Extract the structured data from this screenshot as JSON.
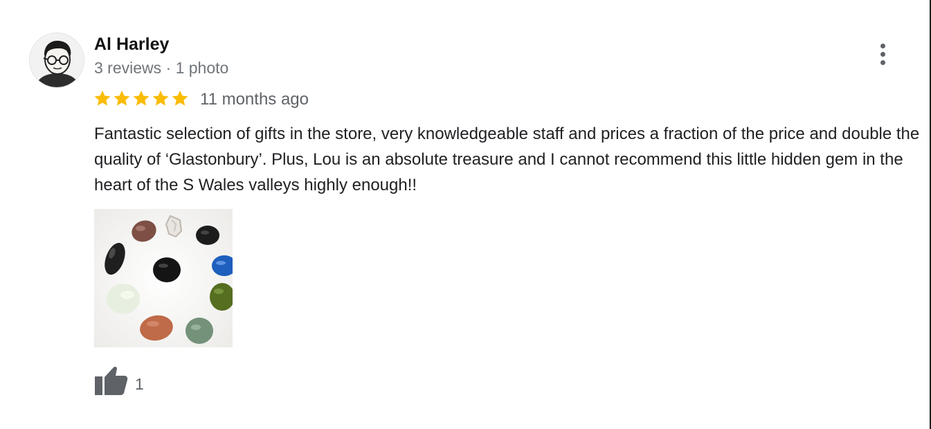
{
  "review": {
    "reviewer_name": "Al Harley",
    "reviewer_meta": "3 reviews · 1 photo",
    "rating": 5,
    "rating_max": 5,
    "time": "11 months ago",
    "text": "Fantastic selection of gifts in the store, very knowledgeable staff and prices a fraction of the price and double the quality of ‘Glastonbury’. Plus, Lou is an absolute treasure and I cannot recommend this little hidden gem in the heart of the S Wales valleys highly enough!!",
    "photo_count": 1,
    "like_count": "1"
  },
  "colors": {
    "star": "#fbbc04",
    "text": "#202124",
    "muted": "#70757a",
    "icon": "#5f6368"
  },
  "icons": {
    "menu": "more-vert-icon",
    "like": "thumb-up-icon",
    "star": "star-icon"
  }
}
